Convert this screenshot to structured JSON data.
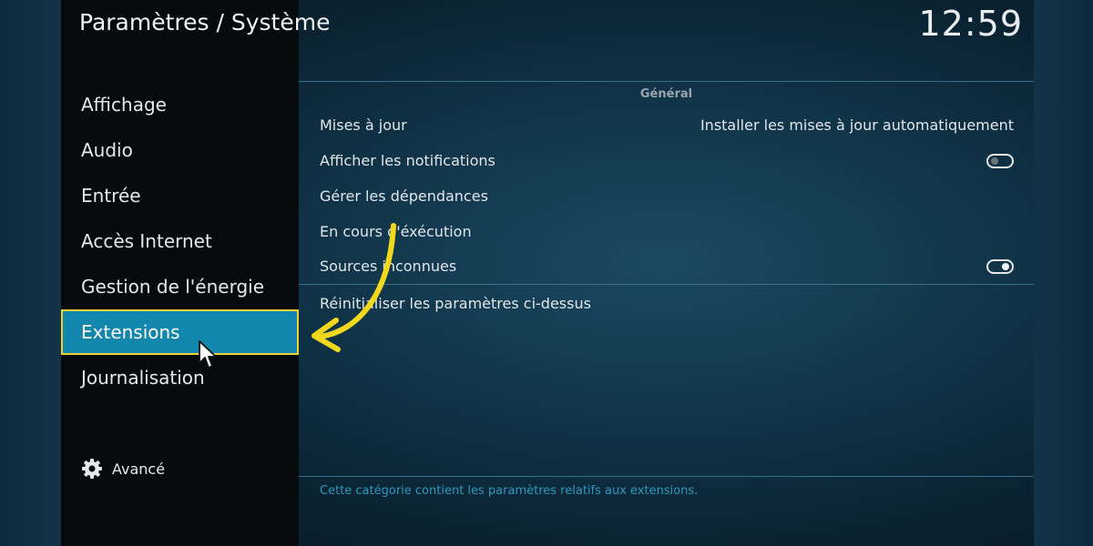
{
  "header": {
    "title": "Paramètres / Système",
    "clock": "12:59"
  },
  "sidebar": {
    "items": [
      {
        "label": "Affichage",
        "active": false
      },
      {
        "label": "Audio",
        "active": false
      },
      {
        "label": "Entrée",
        "active": false
      },
      {
        "label": "Accès Internet",
        "active": false
      },
      {
        "label": "Gestion de l'énergie",
        "active": false
      },
      {
        "label": "Extensions",
        "active": true
      },
      {
        "label": "Journalisation",
        "active": false
      }
    ],
    "advanced": {
      "label": "Avancé",
      "icon": "gear-icon"
    }
  },
  "content": {
    "section_title": "Général",
    "rows": [
      {
        "label": "Mises à jour",
        "value": "Installer les mises à jour automatiquement"
      },
      {
        "label": "Afficher les notifications",
        "toggle": false
      },
      {
        "label": "Gérer les dépendances"
      },
      {
        "label": "En cours d'éxécution"
      },
      {
        "label": "Sources inconnues",
        "toggle": true
      },
      {
        "label": "Réinitialiser les paramètres ci-dessus"
      }
    ],
    "description": "Cette catégorie contient les paramètres relatifs aux extensions."
  },
  "colors": {
    "accent": "#1286ad",
    "highlight_border": "#e8d43a",
    "annotation_arrow": "#f2d81c",
    "description_text": "#2d98bd"
  }
}
